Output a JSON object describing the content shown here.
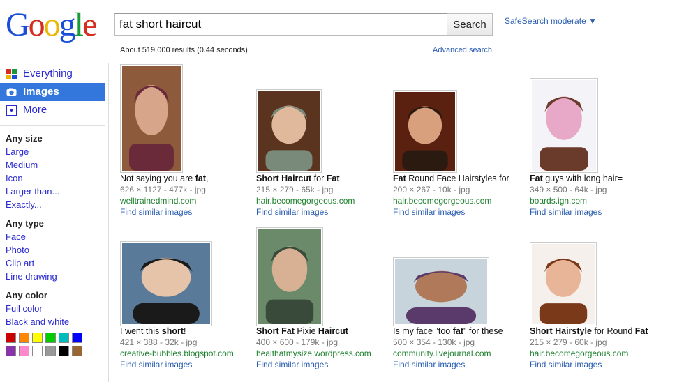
{
  "logo_text": "Google",
  "search": {
    "query": "fat short haircut",
    "button": "Search"
  },
  "safesearch": "SafeSearch moderate ▼",
  "stats": "About 519,000 results (0.44 seconds)",
  "advanced": "Advanced search",
  "nav": {
    "items": [
      {
        "label": "Everything",
        "icon": "everything-icon"
      },
      {
        "label": "Images",
        "icon": "camera-icon"
      },
      {
        "label": "More",
        "icon": "dropdown-icon"
      }
    ]
  },
  "filters": {
    "size": {
      "heading": "Any size",
      "options": [
        "Large",
        "Medium",
        "Icon",
        "Larger than...",
        "Exactly..."
      ]
    },
    "type": {
      "heading": "Any type",
      "options": [
        "Face",
        "Photo",
        "Clip art",
        "Line drawing"
      ]
    },
    "color": {
      "heading": "Any color",
      "options": [
        "Full color",
        "Black and white"
      ],
      "swatches": [
        "#cc0000",
        "#ff8800",
        "#ffff00",
        "#00cc00",
        "#00bbbb",
        "#0000ff",
        "#8833aa",
        "#ff88cc",
        "#ffffff",
        "#999999",
        "#000000",
        "#996633"
      ]
    }
  },
  "results": [
    {
      "pre": "Not saying you are ",
      "bold": "fat",
      "post": ",",
      "meta": "626 × 1127 - 477k - jpg",
      "url": "welltrainedmind.com",
      "similar": "Find similar images"
    },
    {
      "pre": "",
      "bold": "Short Haircut",
      "post": " for ",
      "bold2": "Fat",
      "meta": "215 × 279 - 65k - jpg",
      "url": "hair.becomegorgeous.com",
      "similar": "Find similar images"
    },
    {
      "pre": "",
      "bold": "Fat",
      "post": " Round Face Hairstyles for",
      "meta": "200 × 267 - 10k - jpg",
      "url": "hair.becomegorgeous.com",
      "similar": "Find similar images"
    },
    {
      "pre": "",
      "bold": "Fat",
      "post": " guys with long hair=",
      "meta": "349 × 500 - 64k - jpg",
      "url": "boards.ign.com",
      "similar": "Find similar images"
    },
    {
      "pre": "I went this ",
      "bold": "short",
      "post": "!",
      "meta": "421 × 388 - 32k - jpg",
      "url": "creative-bubbles.blogspot.com",
      "similar": "Find similar images"
    },
    {
      "pre": "",
      "bold": "Short Fat",
      "post": " Pixie ",
      "bold2": "Haircut",
      "meta": "400 × 600 - 179k - jpg",
      "url": "healthatmysize.wordpress.com",
      "similar": "Find similar images"
    },
    {
      "pre": "Is my face \"too ",
      "bold": "fat",
      "post": "\" for these",
      "meta": "500 × 354 - 130k - jpg",
      "url": "community.livejournal.com",
      "similar": "Find similar images"
    },
    {
      "pre": "",
      "bold": "Short Hairstyle",
      "post": " for Round ",
      "bold2": "Fat",
      "meta": "215 × 279 - 60k - jpg",
      "url": "hair.becomegorgeous.com",
      "similar": "Find similar images"
    }
  ]
}
